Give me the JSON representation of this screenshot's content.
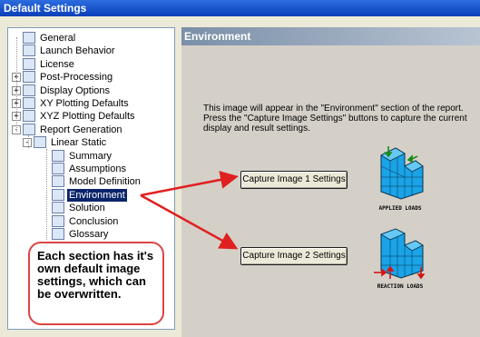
{
  "window": {
    "title": "Default Settings"
  },
  "tree": {
    "items": [
      {
        "label": "General",
        "icon": "general-icon",
        "level": 0
      },
      {
        "label": "Launch Behavior",
        "icon": "launch-icon",
        "level": 0
      },
      {
        "label": "License",
        "icon": "license-icon",
        "level": 0
      },
      {
        "label": "Post-Processing",
        "icon": "postproc-icon",
        "level": 0,
        "expander": "+"
      },
      {
        "label": "Display Options",
        "icon": "display-icon",
        "level": 0,
        "expander": "+"
      },
      {
        "label": "XY Plotting Defaults",
        "icon": "xy-plot-icon",
        "level": 0,
        "expander": "+"
      },
      {
        "label": "XYZ Plotting Defaults",
        "icon": "xyz-plot-icon",
        "level": 0,
        "expander": "+"
      },
      {
        "label": "Report Generation",
        "icon": "report-icon",
        "level": 0,
        "expander": "-"
      },
      {
        "label": "Linear Static",
        "icon": "linear-static-icon",
        "level": 1,
        "expander": "-"
      },
      {
        "label": "Summary",
        "icon": "summary-icon",
        "level": 2
      },
      {
        "label": "Assumptions",
        "icon": "assumptions-icon",
        "level": 2
      },
      {
        "label": "Model Definition",
        "icon": "model-def-icon",
        "level": 2
      },
      {
        "label": "Environment",
        "icon": "environment-icon",
        "level": 2,
        "selected": true
      },
      {
        "label": "Solution",
        "icon": "solution-icon",
        "level": 2
      },
      {
        "label": "Conclusion",
        "icon": "conclusion-icon",
        "level": 2
      },
      {
        "label": "Glossary",
        "icon": "glossary-icon",
        "level": 2
      }
    ]
  },
  "panel": {
    "title": "Environment",
    "description_line1": "This image will appear in the \"Environment\" section of the report.",
    "description_line2": "Press the \"Capture Image Settings\" buttons to capture the current",
    "description_line3": "display and result settings.",
    "capture1_label": "Capture Image 1 Settings",
    "capture2_label": "Capture Image 2 Settings",
    "thumb1_caption": "APPLIED LOADS",
    "thumb2_caption": "REACTION LOADS"
  },
  "callout": {
    "text": "Each section has it's own default image settings, which can be overwritten."
  },
  "colors": {
    "title_bar": "#0a3fb8",
    "selection": "#0a246a",
    "arrow": "#e02020",
    "cube_blue": "#1aa3e6"
  }
}
